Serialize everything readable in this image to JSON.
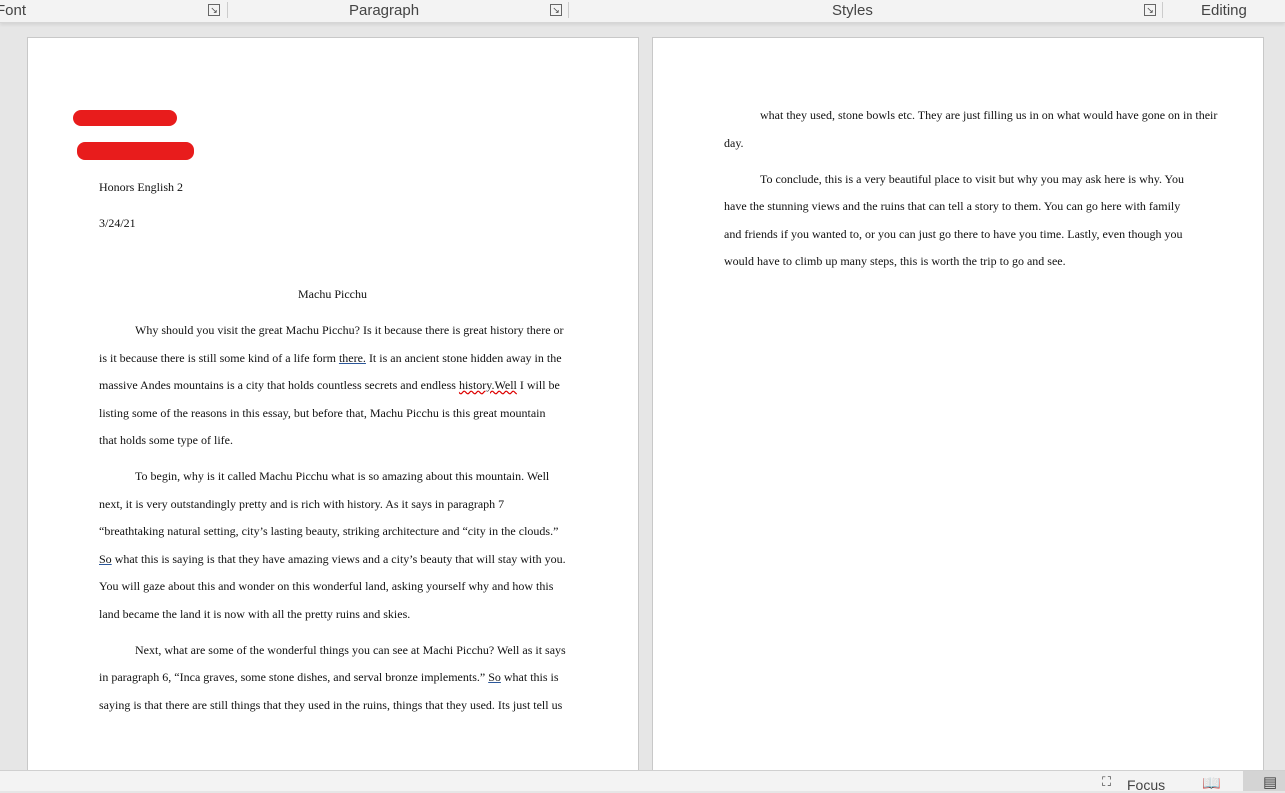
{
  "ribbon": {
    "groups": [
      "Font",
      "Paragraph",
      "Styles",
      "Editing"
    ]
  },
  "page1": {
    "header": [
      "Honors English 2",
      "3/24/21"
    ],
    "title": "Machu Picchu",
    "paragraphs": [
      [
        [
          {
            "t": "Why should you visit the great Machu Picchu? Is it because there is great history there or"
          }
        ],
        [
          {
            "t": "is it because there is still some kind of a life form "
          },
          {
            "t": "there.",
            "s": "u"
          },
          {
            "t": " It is an ancient stone hidden away in the"
          }
        ],
        [
          {
            "t": "massive Andes mountains is a city that holds countless secrets and endless "
          },
          {
            "t": "history.Well",
            "s": "sq"
          },
          {
            "t": " I will be"
          }
        ],
        [
          {
            "t": "listing some of the reasons in this essay, but before that, Machu Picchu is this great mountain"
          }
        ],
        [
          {
            "t": "that holds some type of life."
          }
        ]
      ],
      [
        [
          {
            "t": "To begin, why is it called Machu Picchu what is so amazing about this mountain. Well"
          }
        ],
        [
          {
            "t": "next, it is very outstandingly pretty and is rich with history. As it says in paragraph 7"
          }
        ],
        [
          {
            "t": "“breathtaking natural setting, city’s lasting beauty, striking architecture and “city in the clouds.”"
          }
        ],
        [
          {
            "t": "So",
            "s": "u"
          },
          {
            "t": " what this is saying is that they have amazing views and a city’s beauty that will stay with you."
          }
        ],
        [
          {
            "t": "You will gaze about this and wonder on this wonderful land, asking yourself why and how this"
          }
        ],
        [
          {
            "t": "land became the land it is now with all the pretty ruins and skies."
          }
        ]
      ],
      [
        [
          {
            "t": "Next, what are some of the wonderful things you can see at Machi Picchu? Well as it says"
          }
        ],
        [
          {
            "t": "in paragraph 6, “Inca graves, some stone dishes, and serval bronze implements.” "
          },
          {
            "t": "So",
            "s": "u"
          },
          {
            "t": " what this is"
          }
        ],
        [
          {
            "t": "saying is that there are still things that they used in the ruins, things that they used. Its just tell us"
          }
        ]
      ]
    ]
  },
  "page2": {
    "paragraphs": [
      [
        [
          {
            "t": "what they used, stone bowls etc. They are just filling us in on what would have gone on in their"
          }
        ],
        [
          {
            "t": "day."
          }
        ]
      ],
      [
        [
          {
            "t": "To conclude, this is a very beautiful place to visit but why you may ask here is why. You"
          }
        ],
        [
          {
            "t": "have the stunning views and the ruins that can tell a story to them. You can go here with family"
          }
        ],
        [
          {
            "t": "and friends if you wanted to, or you can just go there to have you time. Lastly, even though you"
          }
        ],
        [
          {
            "t": "would have to climb up many steps, this is worth the trip to go and see."
          }
        ]
      ]
    ]
  },
  "status": {
    "focus": "Focus"
  }
}
